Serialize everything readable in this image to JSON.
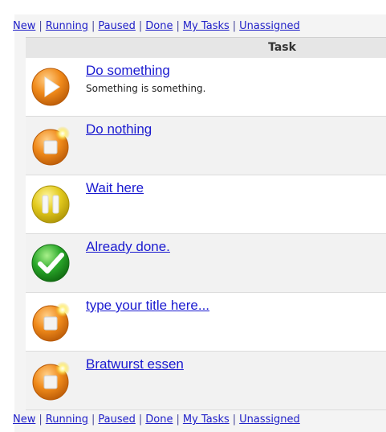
{
  "filters": [
    "New",
    "Running",
    "Paused",
    "Done",
    "My Tasks",
    "Unassigned"
  ],
  "table": {
    "column_header": "Task"
  },
  "colors": {
    "link": "#1a1ad0",
    "running": "#f08a1a",
    "new": "#f08a1a",
    "paused": "#e2c91c",
    "done": "#2aa82a"
  },
  "tasks": [
    {
      "status": "running",
      "icon": "play-icon",
      "title": "Do something",
      "description": "Something is something."
    },
    {
      "status": "new",
      "icon": "new-stop-icon",
      "title": "Do nothing",
      "description": ""
    },
    {
      "status": "paused",
      "icon": "pause-icon",
      "title": "Wait here",
      "description": ""
    },
    {
      "status": "done",
      "icon": "checkmark-icon",
      "title": "Already done.",
      "description": ""
    },
    {
      "status": "new",
      "icon": "new-stop-icon",
      "title": "type your title here...",
      "description": ""
    },
    {
      "status": "new",
      "icon": "new-stop-icon",
      "title": "Bratwurst essen",
      "description": ""
    }
  ]
}
